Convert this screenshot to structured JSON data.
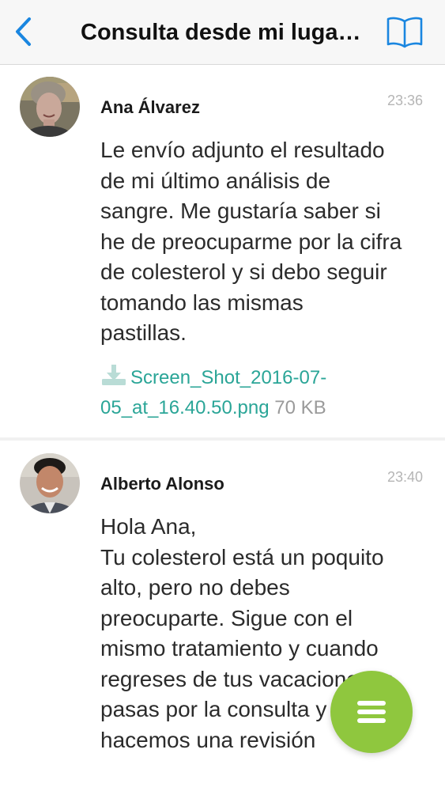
{
  "navbar": {
    "title": "Consulta desde mi lugar de vacaciones",
    "back_icon": "chevron-left-icon",
    "book_icon": "book-icon",
    "accent": "#1a86e0"
  },
  "messages": [
    {
      "sender": "Ana Álvarez",
      "time": "23:36",
      "text": "Le envío adjunto el resultado\nde mi último análisis de\nsangre. Me gustaría saber si\nhe de preocuparme por la cifra\nde colesterol y si debo seguir\ntomando las mismas\npastillas.",
      "attachment": {
        "icon": "download-icon",
        "file_name_line1": "Screen_Shot_2016-07-",
        "file_name_line2": "05_at_16.40.50.png",
        "size": "70 KB"
      }
    },
    {
      "sender": "Alberto Alonso",
      "time": "23:40",
      "text": "Hola Ana,\nTu colesterol está un poquito\nalto, pero no debes\npreocuparte. Sigue con el\nmismo tratamiento y cuando\nregreses de tus vacaciones te\npasas por la consulta y\nhacemos una revisión"
    }
  ],
  "fab": {
    "icon": "menu-icon",
    "color": "#8fc73e"
  },
  "colors": {
    "link": "#2aa597",
    "time": "#b5b5b5"
  }
}
